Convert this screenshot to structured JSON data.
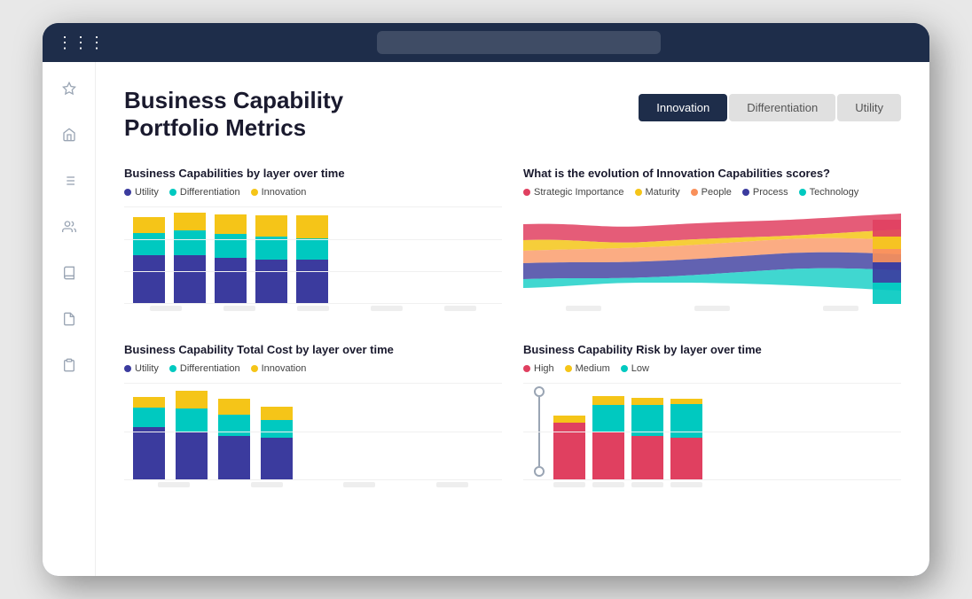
{
  "browser": {
    "address": ""
  },
  "page": {
    "title_line1": "Business Capability",
    "title_line2": "Portfolio Metrics"
  },
  "tabs": [
    {
      "label": "Innovation",
      "active": true
    },
    {
      "label": "Differentiation",
      "active": false
    },
    {
      "label": "Utility",
      "active": false
    }
  ],
  "charts": {
    "chart1": {
      "title": "Business Capabilities by layer over time",
      "legend": [
        {
          "label": "Utility",
          "color": "#3b3b9e"
        },
        {
          "label": "Differentiation",
          "color": "#00c9c0"
        },
        {
          "label": "Innovation",
          "color": "#f5c518"
        }
      ],
      "bars": [
        {
          "utility": 55,
          "diff": 25,
          "innov": 18
        },
        {
          "utility": 55,
          "diff": 28,
          "innov": 20
        },
        {
          "utility": 52,
          "diff": 27,
          "innov": 22
        },
        {
          "utility": 50,
          "diff": 26,
          "innov": 24
        },
        {
          "utility": 50,
          "diff": 24,
          "innov": 26
        }
      ]
    },
    "chart2": {
      "title": "What is the evolution of Innovation Capabilities scores?",
      "legend": [
        {
          "label": "Strategic Importance",
          "color": "#e04060"
        },
        {
          "label": "Maturity",
          "color": "#f5c518"
        },
        {
          "label": "People",
          "color": "#f9905a"
        },
        {
          "label": "Process",
          "color": "#3b3b9e"
        },
        {
          "label": "Technology",
          "color": "#00c9c0"
        }
      ]
    },
    "chart3": {
      "title": "Business Capability Total Cost by layer over time",
      "legend": [
        {
          "label": "Utility",
          "color": "#3b3b9e"
        },
        {
          "label": "Differentiation",
          "color": "#00c9c0"
        },
        {
          "label": "Innovation",
          "color": "#f5c518"
        }
      ],
      "bars": [
        {
          "utility": 60,
          "diff": 22,
          "innov": 12
        },
        {
          "utility": 55,
          "diff": 26,
          "innov": 20
        },
        {
          "utility": 50,
          "diff": 24,
          "innov": 18
        },
        {
          "utility": 48,
          "diff": 20,
          "innov": 15
        }
      ]
    },
    "chart4": {
      "title": "Business Capability Risk by layer over time",
      "legend": [
        {
          "label": "High",
          "color": "#e04060"
        },
        {
          "label": "Medium",
          "color": "#f5c518"
        },
        {
          "label": "Low",
          "color": "#00c9c0"
        }
      ],
      "bars": [
        {
          "high": 65,
          "medium": 8,
          "low": 0
        },
        {
          "high": 55,
          "medium": 10,
          "low": 30
        },
        {
          "high": 50,
          "medium": 8,
          "low": 35
        },
        {
          "high": 48,
          "medium": 6,
          "low": 38
        }
      ]
    }
  },
  "sidebar_icons": [
    "grid",
    "star",
    "home",
    "list",
    "users",
    "book",
    "file",
    "clipboard"
  ]
}
